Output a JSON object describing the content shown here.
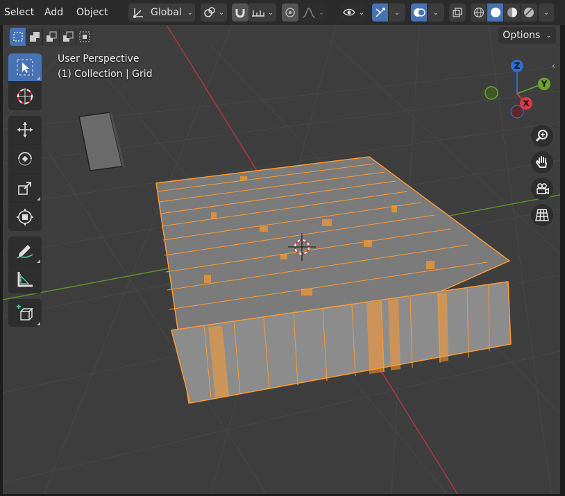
{
  "menu": {
    "select": "Select",
    "add": "Add",
    "object": "Object"
  },
  "transform": {
    "orientation": "Global"
  },
  "options_label": "Options",
  "overlay": {
    "view_name": "User Perspective",
    "collection": "(1) Collection | Grid"
  },
  "gizmo": {
    "z": "Z",
    "y": "Y",
    "x": "X"
  },
  "colors": {
    "header_bg": "#2b2b2b",
    "viewport_bg": "#3e3e3e",
    "accent": "#4772b3",
    "selection": "#ffa033",
    "axis_x": "#c83c3c",
    "axis_y": "#5f9a2b",
    "axis_z": "#2b6fd1"
  }
}
